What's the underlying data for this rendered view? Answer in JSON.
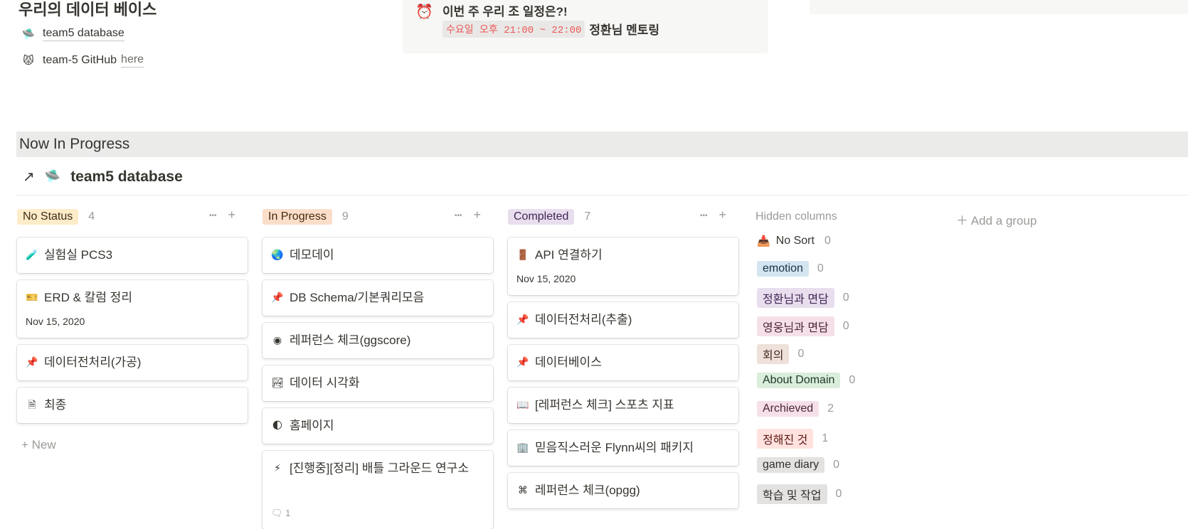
{
  "header": {
    "title": "우리의 데이터 베이스",
    "links": [
      {
        "icon": "ufo-icon",
        "glyph": "🛸",
        "text": "team5 database",
        "suffix": ""
      },
      {
        "icon": "cat-icon",
        "glyph": "😾",
        "text": "team-5 GitHub",
        "suffix": "here"
      }
    ]
  },
  "callout": {
    "icon": "alarm-clock-icon",
    "glyph": "⏰",
    "heading": "이번 주 우리 조 일정은?!",
    "schedule_code": "수요일 오후 21:00 ~ 22:00",
    "schedule_text": "정환님 멘토링"
  },
  "section": {
    "banner": "Now In Progress",
    "database_title": "team5 database",
    "database_icon_glyph": "🛸"
  },
  "board": {
    "columns": [
      {
        "label": "No Status",
        "count": "4",
        "bg": "#fdecc8",
        "fg": "#402c1b",
        "cards": [
          {
            "icon": "test-tube-icon",
            "glyph": "🧪",
            "title": "실험실 PCS3",
            "date": "",
            "comments": ""
          },
          {
            "icon": "ticket-icon",
            "glyph": "🎫",
            "title": "ERD & 칼럼 정리",
            "date": "Nov 15, 2020",
            "comments": ""
          },
          {
            "icon": "pin-icon",
            "glyph": "📌",
            "title": "데이터전처리(가공)",
            "date": "",
            "comments": ""
          },
          {
            "icon": "page-icon",
            "glyph": "🗎",
            "title": "최종",
            "date": "",
            "comments": ""
          }
        ],
        "new_label": "New"
      },
      {
        "label": "In Progress",
        "count": "9",
        "bg": "#fadec9",
        "fg": "#49290e",
        "cards": [
          {
            "icon": "globe-icon",
            "glyph": "🌏",
            "title": "데모데이",
            "date": "",
            "comments": ""
          },
          {
            "icon": "pin-icon",
            "glyph": "📌",
            "title": "DB Schema/기본쿼리모음",
            "date": "",
            "comments": ""
          },
          {
            "icon": "ggscore-icon",
            "glyph": "◉",
            "title": "레퍼런스 체크(ggscore)",
            "date": "",
            "comments": ""
          },
          {
            "icon": "picture-icon",
            "glyph": "🏞",
            "title": "데이터 시각화",
            "date": "",
            "comments": ""
          },
          {
            "icon": "moon-icon",
            "glyph": "🌓",
            "title": "홈페이지",
            "date": "",
            "comments": ""
          },
          {
            "icon": "lightning-icon",
            "glyph": "⚡",
            "title": "[진행중][정리] 배틀 그라운드 연구소",
            "date": "",
            "comments": "1"
          }
        ]
      },
      {
        "label": "Completed",
        "count": "7",
        "bg": "#e8deee",
        "fg": "#412454",
        "cards": [
          {
            "icon": "door-icon",
            "glyph": "🚪",
            "title": "API 연결하기",
            "date": "Nov 15, 2020",
            "comments": ""
          },
          {
            "icon": "pin-icon",
            "glyph": "📌",
            "title": "데이터전처리(추출)",
            "date": "",
            "comments": ""
          },
          {
            "icon": "pin-icon",
            "glyph": "📌",
            "title": "데이터베이스",
            "date": "",
            "comments": ""
          },
          {
            "icon": "book-icon",
            "glyph": "📖",
            "title": "[레퍼런스 체크] 스포츠 지표",
            "date": "",
            "comments": ""
          },
          {
            "icon": "building-icon",
            "glyph": "🏢",
            "title": "믿음직스러운 Flynn씨의 패키지",
            "date": "",
            "comments": ""
          },
          {
            "icon": "app-icon",
            "glyph": "⌘",
            "title": "레퍼런스 체크(opgg)",
            "date": "",
            "comments": ""
          }
        ]
      }
    ],
    "hidden_label": "Hidden columns",
    "add_group_label": "Add a group",
    "hidden_columns": [
      {
        "label": "No Sort",
        "count": "0",
        "bg": "transparent",
        "fg": "#37352f",
        "icon": "inbox-icon"
      },
      {
        "label": "emotion",
        "count": "0",
        "bg": "#d3e5ef",
        "fg": "#183347"
      },
      {
        "label": "정환님과 면담",
        "count": "0",
        "bg": "#e8deee",
        "fg": "#412454"
      },
      {
        "label": "영웅님과 면담",
        "count": "0",
        "bg": "#f5e0e9",
        "fg": "#4c2337"
      },
      {
        "label": "회의",
        "count": "0",
        "bg": "#eee0da",
        "fg": "#442a1e"
      },
      {
        "label": "About Domain",
        "count": "0",
        "bg": "#dbeddb",
        "fg": "#1c3829"
      },
      {
        "label": "Archieved",
        "count": "2",
        "bg": "#f5e0e9",
        "fg": "#4c2337"
      },
      {
        "label": "정해진 것",
        "count": "1",
        "bg": "#ffe2dd",
        "fg": "#5d1715"
      },
      {
        "label": "game diary",
        "count": "0",
        "bg": "#e3e2e0",
        "fg": "#32302c"
      },
      {
        "label": "학습 및 작업",
        "count": "0",
        "bg": "#e3e2e0",
        "fg": "#32302c"
      }
    ]
  }
}
